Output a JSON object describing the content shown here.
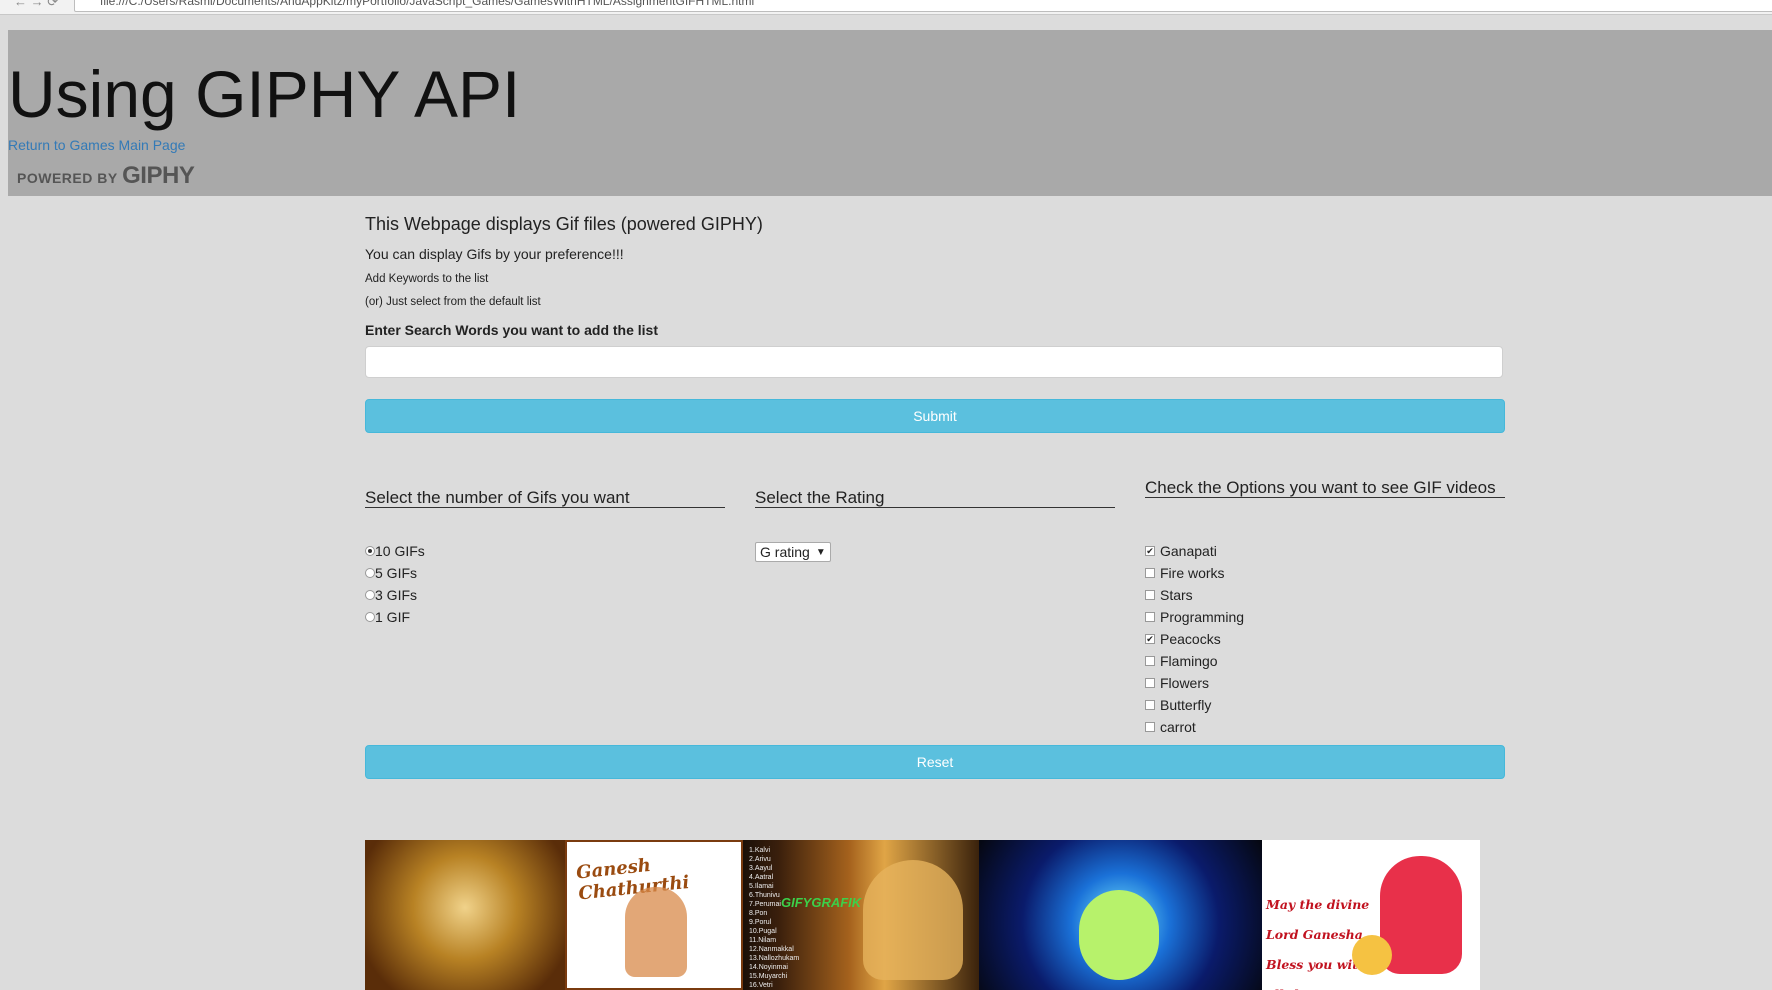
{
  "browser": {
    "url": "file:///C:/Users/Rasmi/Documents/AndAppKitz/myPortfolio/JavaScript_Games/GamesWithHTML/AssignmentGIFHTML.html"
  },
  "header": {
    "title": "Using GIPHY API",
    "back_link": "Return to Games Main Page",
    "powered_small": "POWERED BY",
    "powered_brand": "GIPHY"
  },
  "intro": {
    "lead": "This Webpage displays Gif files (powered GIPHY)",
    "preference": "You can display Gifs by your preference!!!",
    "add_keywords": "Add Keywords to the list",
    "or_select": "(or) Just select from the default list",
    "search_label": "Enter Search Words you want to add the list"
  },
  "search": {
    "value": "",
    "placeholder": ""
  },
  "buttons": {
    "submit": "Submit",
    "reset": "Reset"
  },
  "count_section": {
    "heading": "Select the number of Gifs you want",
    "options": [
      {
        "label": "10 GIFs",
        "selected": true
      },
      {
        "label": "5 GIFs",
        "selected": false
      },
      {
        "label": "3 GIFs",
        "selected": false
      },
      {
        "label": "1 GIF",
        "selected": false
      }
    ]
  },
  "rating_section": {
    "heading": "Select the Rating",
    "selected": "G rating"
  },
  "options_section": {
    "heading": "Check the Options you want to see GIF videos",
    "items": [
      {
        "label": "Ganapati",
        "checked": true
      },
      {
        "label": "Fire works",
        "checked": false
      },
      {
        "label": "Stars",
        "checked": false
      },
      {
        "label": "Programming",
        "checked": false
      },
      {
        "label": "Peacocks",
        "checked": true
      },
      {
        "label": "Flamingo",
        "checked": false
      },
      {
        "label": "Flowers",
        "checked": false
      },
      {
        "label": "Butterfly",
        "checked": false
      },
      {
        "label": "carrot",
        "checked": false
      }
    ]
  },
  "gifs": {
    "g2_caption": "Ganesh Chathurthi",
    "g3_badge": "GIFYGRAFIK",
    "g3_list": "1.Kalvi\n2.Arivu\n3.Aayul\n4.Aatral\n5.Ilamai\n6.Thunivu\n7.Perumai\n8.Pon\n9.Porul\n10.Pugal\n11.Nilam\n12.Nanmakkal\n13.Nallozhukam\n14.Noyinmai\n15.Muyarchi\n16.Vetri",
    "g5_text": "May the divine\nLord Ganesha\nBless you with\nall thats pure"
  },
  "colors": {
    "page_bg": "#dcdcdc",
    "header_bg": "#a9a9a9",
    "link": "#337ab7",
    "button": "#5bc0de"
  }
}
